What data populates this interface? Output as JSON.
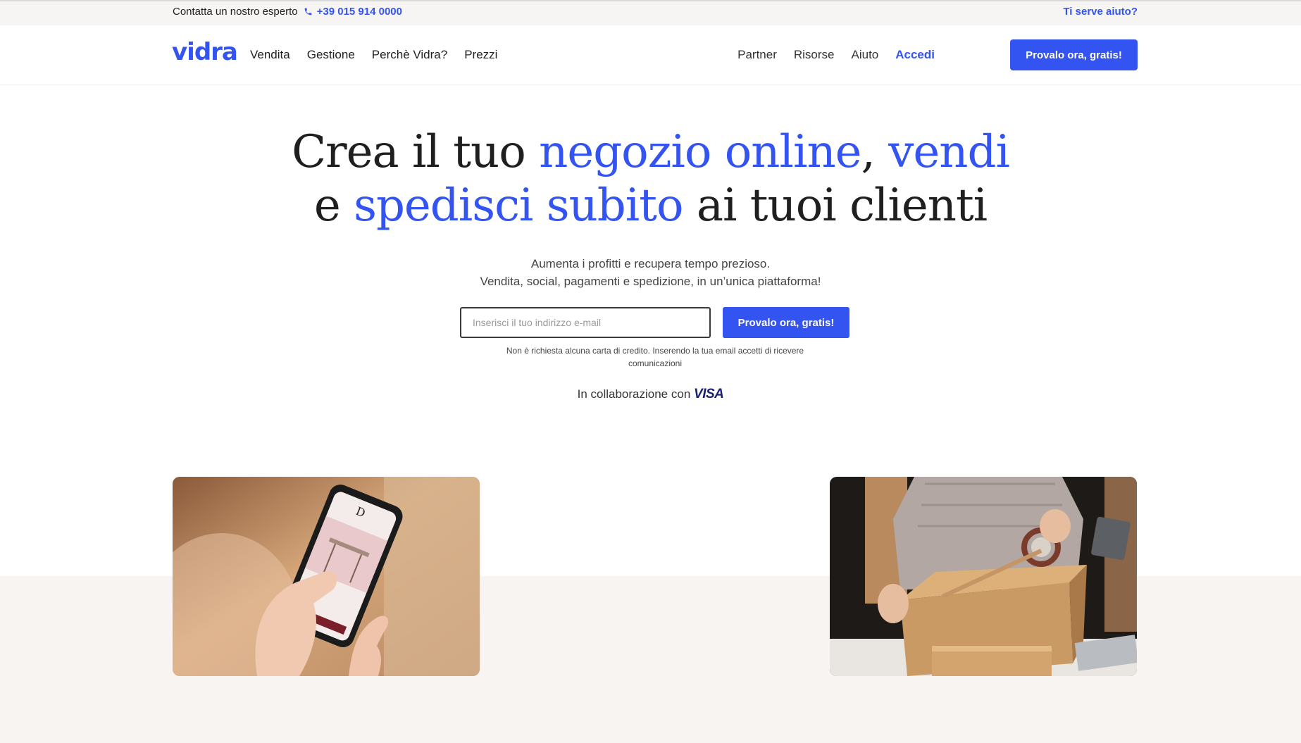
{
  "topbar": {
    "contact_label": "Contatta un nostro esperto",
    "phone": "+39 015 914 0000",
    "help_link": "Ti serve aiuto?"
  },
  "navbar": {
    "logo": "vidra",
    "left_links": [
      "Vendita",
      "Gestione",
      "Perchè Vidra?",
      "Prezzi"
    ],
    "right_links": [
      "Partner",
      "Risorse",
      "Aiuto"
    ],
    "login": "Accedi",
    "cta": "Provalo ora, gratis!"
  },
  "hero": {
    "title_line1_a": "Crea il tuo ",
    "title_line1_hl": "negozio online",
    "title_line1_b": ", ",
    "title_line1_hl2": "vendi",
    "title_line2_a": "e ",
    "title_line2_hl": "spedisci subito",
    "title_line2_b": " ai tuoi clienti",
    "subtitle_line1": "Aumenta i profitti e recupera tempo prezioso.",
    "subtitle_line2": "Vendita, social, pagamenti e spedizione, in un’unica piattaforma!"
  },
  "signup": {
    "email_placeholder": "Inserisci il tuo indirizzo e-mail",
    "cta": "Provalo ora, gratis!",
    "disclaimer": "Non è richiesta alcuna carta di credito. Inserendo la tua email accetti di ricevere comunicazioni"
  },
  "collab": {
    "label": "In collaborazione con",
    "brand": "VISA"
  },
  "colors": {
    "accent": "#3454f1",
    "beige_band": "#f7f4f1",
    "topbar_bg": "#f7f5f3"
  },
  "icons": {
    "phone": "phone-icon"
  }
}
